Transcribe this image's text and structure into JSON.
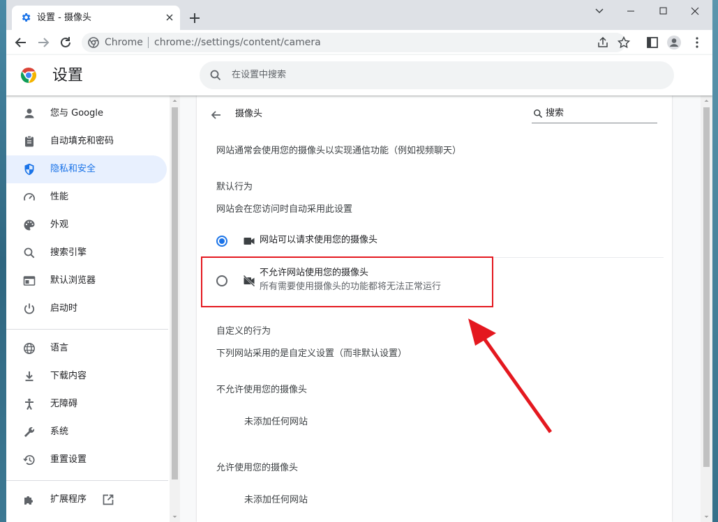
{
  "browser": {
    "tab_title": "设置 - 摄像头",
    "omnibox_brand": "Chrome",
    "url": "chrome://settings/content/camera"
  },
  "settings": {
    "header_title": "设置",
    "search_placeholder": "在设置中搜索",
    "nav_items": [
      {
        "label": "您与 Google",
        "icon": "person-icon"
      },
      {
        "label": "自动填充和密码",
        "icon": "clipboard-icon"
      },
      {
        "label": "隐私和安全",
        "icon": "shield-icon",
        "active": true
      },
      {
        "label": "性能",
        "icon": "speedometer-icon"
      },
      {
        "label": "外观",
        "icon": "palette-icon"
      },
      {
        "label": "搜索引擎",
        "icon": "search-icon"
      },
      {
        "label": "默认浏览器",
        "icon": "browser-icon"
      },
      {
        "label": "启动时",
        "icon": "power-icon"
      },
      {
        "label": "语言",
        "icon": "globe-icon"
      },
      {
        "label": "下载内容",
        "icon": "download-icon"
      },
      {
        "label": "无障碍",
        "icon": "accessibility-icon"
      },
      {
        "label": "系统",
        "icon": "wrench-icon"
      },
      {
        "label": "重置设置",
        "icon": "history-icon"
      },
      {
        "label": "扩展程序",
        "icon": "puzzle-icon"
      }
    ]
  },
  "camera_page": {
    "title": "摄像头",
    "search_label": "搜索",
    "description": "网站通常会使用您的摄像头以实现通信功能（例如视频聊天）",
    "default_behavior_heading": "默认行为",
    "default_behavior_desc": "网站会在您访问时自动采用此设置",
    "option_allow": "网站可以请求使用您的摄像头",
    "option_block": "不允许网站使用您的摄像头",
    "option_block_desc": "所有需要使用摄像头的功能都将无法正常运行",
    "custom_heading": "自定义的行为",
    "custom_desc": "下列网站采用的是自定义设置（而非默认设置）",
    "blocked_heading": "不允许使用您的摄像头",
    "blocked_empty": "未添加任何网站",
    "allowed_heading": "允许使用您的摄像头",
    "allowed_empty": "未添加任何网站",
    "selected_option": "allow"
  },
  "colors": {
    "accent": "#1a73e8",
    "annotation": "#e4181f"
  }
}
